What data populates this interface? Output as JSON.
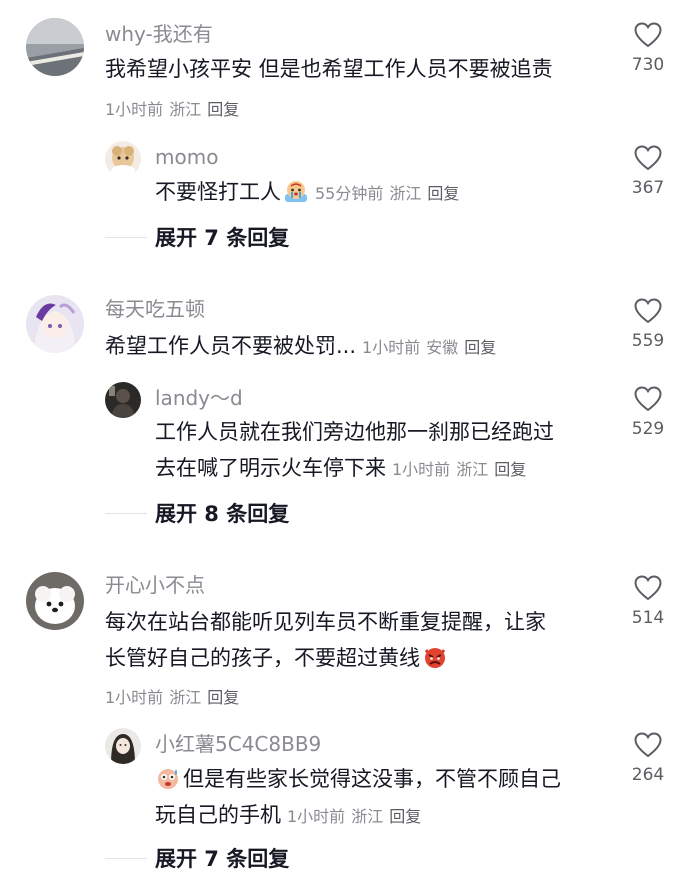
{
  "comments": [
    {
      "username": "why-我还有",
      "text": "我希望小孩平安 但是也希望工作人员不要被追责",
      "time": "1小时前",
      "location": "浙江",
      "reply": "回复",
      "likes": "730",
      "replies": [
        {
          "username": "momo",
          "text": "不要怪打工人",
          "emoji": "crying-face-emoji",
          "time": "55分钟前",
          "location": "浙江",
          "reply": "回复",
          "likes": "367"
        }
      ],
      "expand": "展开 7 条回复"
    },
    {
      "username": "每天吃五顿",
      "text": "希望工作人员不要被处罚...",
      "time": "1小时前",
      "location": "安徽",
      "reply": "回复",
      "likes": "559",
      "replies": [
        {
          "username": "landy～d",
          "text_line1": "工作人员就在我们旁边他那一刹那已经跑过",
          "text_line2": "去在喊了明示火车停下来",
          "time": "1小时前",
          "location": "浙江",
          "reply": "回复",
          "likes": "529"
        }
      ],
      "expand": "展开 8 条回复"
    },
    {
      "username": "开心小不点",
      "text_line1": "每次在站台都能听见列车员不断重复提醒，让家",
      "text_line2": "长管好自己的孩子，不要超过黄线",
      "emoji": "angry-devil-emoji",
      "time": "1小时前",
      "location": "浙江",
      "reply": "回复",
      "likes": "514",
      "replies": [
        {
          "username": "小红薯5C4C8BB9",
          "emoji": "sweating-face-emoji",
          "text_line1": "但是有些家长觉得这没事，不管不顾自己",
          "text_line2": "玩自己的手机",
          "time": "1小时前",
          "location": "浙江",
          "reply": "回复",
          "likes": "264"
        }
      ],
      "expand": "展开 7 条回复"
    }
  ],
  "colors": {
    "text": "#161823",
    "muted": "#8a8b91",
    "secondary": "#5c5d63"
  }
}
